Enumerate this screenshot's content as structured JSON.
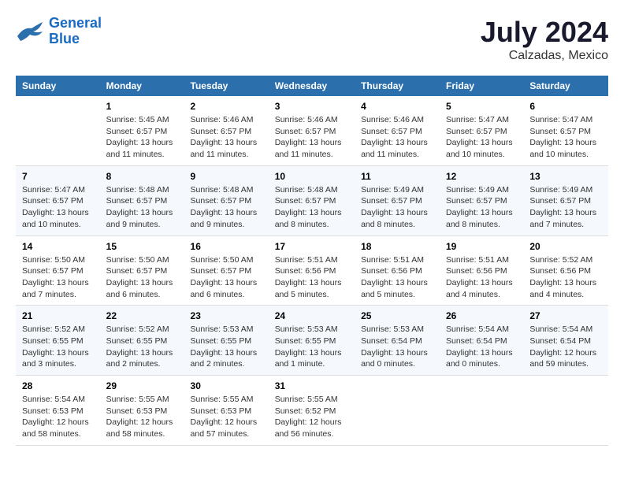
{
  "logo": {
    "name_part1": "General",
    "name_part2": "Blue"
  },
  "title": "July 2024",
  "location": "Calzadas, Mexico",
  "days_of_week": [
    "Sunday",
    "Monday",
    "Tuesday",
    "Wednesday",
    "Thursday",
    "Friday",
    "Saturday"
  ],
  "weeks": [
    [
      {
        "day": "",
        "sunrise": "",
        "sunset": "",
        "daylight": ""
      },
      {
        "day": "1",
        "sunrise": "Sunrise: 5:45 AM",
        "sunset": "Sunset: 6:57 PM",
        "daylight": "Daylight: 13 hours and 11 minutes."
      },
      {
        "day": "2",
        "sunrise": "Sunrise: 5:46 AM",
        "sunset": "Sunset: 6:57 PM",
        "daylight": "Daylight: 13 hours and 11 minutes."
      },
      {
        "day": "3",
        "sunrise": "Sunrise: 5:46 AM",
        "sunset": "Sunset: 6:57 PM",
        "daylight": "Daylight: 13 hours and 11 minutes."
      },
      {
        "day": "4",
        "sunrise": "Sunrise: 5:46 AM",
        "sunset": "Sunset: 6:57 PM",
        "daylight": "Daylight: 13 hours and 11 minutes."
      },
      {
        "day": "5",
        "sunrise": "Sunrise: 5:47 AM",
        "sunset": "Sunset: 6:57 PM",
        "daylight": "Daylight: 13 hours and 10 minutes."
      },
      {
        "day": "6",
        "sunrise": "Sunrise: 5:47 AM",
        "sunset": "Sunset: 6:57 PM",
        "daylight": "Daylight: 13 hours and 10 minutes."
      }
    ],
    [
      {
        "day": "7",
        "sunrise": "Sunrise: 5:47 AM",
        "sunset": "Sunset: 6:57 PM",
        "daylight": "Daylight: 13 hours and 10 minutes."
      },
      {
        "day": "8",
        "sunrise": "Sunrise: 5:48 AM",
        "sunset": "Sunset: 6:57 PM",
        "daylight": "Daylight: 13 hours and 9 minutes."
      },
      {
        "day": "9",
        "sunrise": "Sunrise: 5:48 AM",
        "sunset": "Sunset: 6:57 PM",
        "daylight": "Daylight: 13 hours and 9 minutes."
      },
      {
        "day": "10",
        "sunrise": "Sunrise: 5:48 AM",
        "sunset": "Sunset: 6:57 PM",
        "daylight": "Daylight: 13 hours and 8 minutes."
      },
      {
        "day": "11",
        "sunrise": "Sunrise: 5:49 AM",
        "sunset": "Sunset: 6:57 PM",
        "daylight": "Daylight: 13 hours and 8 minutes."
      },
      {
        "day": "12",
        "sunrise": "Sunrise: 5:49 AM",
        "sunset": "Sunset: 6:57 PM",
        "daylight": "Daylight: 13 hours and 8 minutes."
      },
      {
        "day": "13",
        "sunrise": "Sunrise: 5:49 AM",
        "sunset": "Sunset: 6:57 PM",
        "daylight": "Daylight: 13 hours and 7 minutes."
      }
    ],
    [
      {
        "day": "14",
        "sunrise": "Sunrise: 5:50 AM",
        "sunset": "Sunset: 6:57 PM",
        "daylight": "Daylight: 13 hours and 7 minutes."
      },
      {
        "day": "15",
        "sunrise": "Sunrise: 5:50 AM",
        "sunset": "Sunset: 6:57 PM",
        "daylight": "Daylight: 13 hours and 6 minutes."
      },
      {
        "day": "16",
        "sunrise": "Sunrise: 5:50 AM",
        "sunset": "Sunset: 6:57 PM",
        "daylight": "Daylight: 13 hours and 6 minutes."
      },
      {
        "day": "17",
        "sunrise": "Sunrise: 5:51 AM",
        "sunset": "Sunset: 6:56 PM",
        "daylight": "Daylight: 13 hours and 5 minutes."
      },
      {
        "day": "18",
        "sunrise": "Sunrise: 5:51 AM",
        "sunset": "Sunset: 6:56 PM",
        "daylight": "Daylight: 13 hours and 5 minutes."
      },
      {
        "day": "19",
        "sunrise": "Sunrise: 5:51 AM",
        "sunset": "Sunset: 6:56 PM",
        "daylight": "Daylight: 13 hours and 4 minutes."
      },
      {
        "day": "20",
        "sunrise": "Sunrise: 5:52 AM",
        "sunset": "Sunset: 6:56 PM",
        "daylight": "Daylight: 13 hours and 4 minutes."
      }
    ],
    [
      {
        "day": "21",
        "sunrise": "Sunrise: 5:52 AM",
        "sunset": "Sunset: 6:55 PM",
        "daylight": "Daylight: 13 hours and 3 minutes."
      },
      {
        "day": "22",
        "sunrise": "Sunrise: 5:52 AM",
        "sunset": "Sunset: 6:55 PM",
        "daylight": "Daylight: 13 hours and 2 minutes."
      },
      {
        "day": "23",
        "sunrise": "Sunrise: 5:53 AM",
        "sunset": "Sunset: 6:55 PM",
        "daylight": "Daylight: 13 hours and 2 minutes."
      },
      {
        "day": "24",
        "sunrise": "Sunrise: 5:53 AM",
        "sunset": "Sunset: 6:55 PM",
        "daylight": "Daylight: 13 hours and 1 minute."
      },
      {
        "day": "25",
        "sunrise": "Sunrise: 5:53 AM",
        "sunset": "Sunset: 6:54 PM",
        "daylight": "Daylight: 13 hours and 0 minutes."
      },
      {
        "day": "26",
        "sunrise": "Sunrise: 5:54 AM",
        "sunset": "Sunset: 6:54 PM",
        "daylight": "Daylight: 13 hours and 0 minutes."
      },
      {
        "day": "27",
        "sunrise": "Sunrise: 5:54 AM",
        "sunset": "Sunset: 6:54 PM",
        "daylight": "Daylight: 12 hours and 59 minutes."
      }
    ],
    [
      {
        "day": "28",
        "sunrise": "Sunrise: 5:54 AM",
        "sunset": "Sunset: 6:53 PM",
        "daylight": "Daylight: 12 hours and 58 minutes."
      },
      {
        "day": "29",
        "sunrise": "Sunrise: 5:55 AM",
        "sunset": "Sunset: 6:53 PM",
        "daylight": "Daylight: 12 hours and 58 minutes."
      },
      {
        "day": "30",
        "sunrise": "Sunrise: 5:55 AM",
        "sunset": "Sunset: 6:53 PM",
        "daylight": "Daylight: 12 hours and 57 minutes."
      },
      {
        "day": "31",
        "sunrise": "Sunrise: 5:55 AM",
        "sunset": "Sunset: 6:52 PM",
        "daylight": "Daylight: 12 hours and 56 minutes."
      },
      {
        "day": "",
        "sunrise": "",
        "sunset": "",
        "daylight": ""
      },
      {
        "day": "",
        "sunrise": "",
        "sunset": "",
        "daylight": ""
      },
      {
        "day": "",
        "sunrise": "",
        "sunset": "",
        "daylight": ""
      }
    ]
  ]
}
